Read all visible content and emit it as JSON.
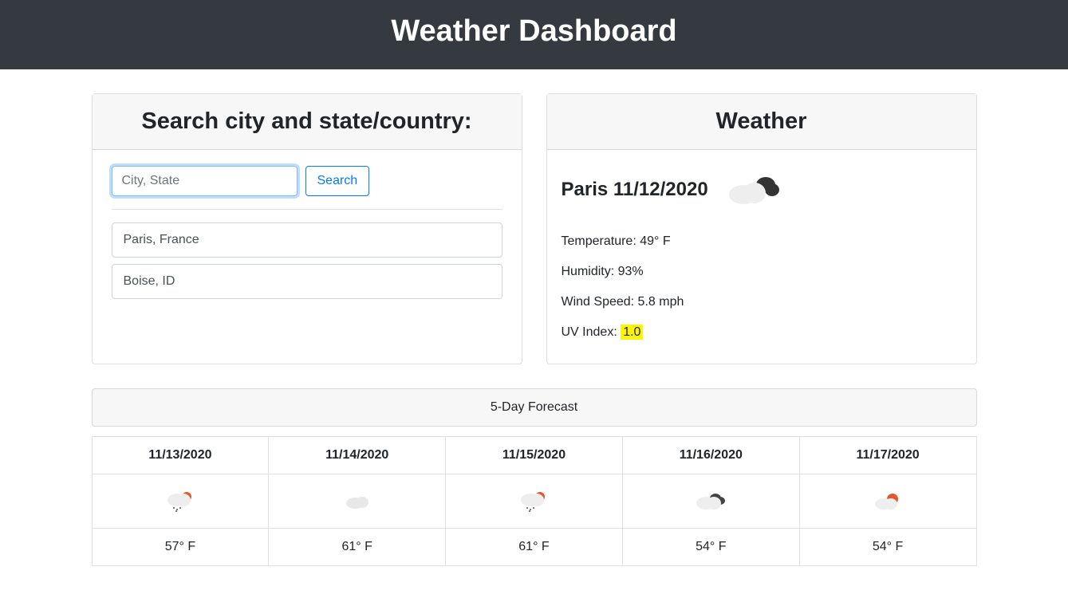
{
  "header": {
    "title": "Weather Dashboard"
  },
  "search": {
    "title": "Search city and state/country:",
    "placeholder": "City, State",
    "button_label": "Search",
    "history": [
      "Paris, France",
      "Boise, ID"
    ]
  },
  "current": {
    "header": "Weather",
    "title": "Paris 11/12/2020",
    "icon": "cloud-dark",
    "temperature_label": "Temperature: 49° F",
    "humidity_label": "Humidity: 93%",
    "wind_label": "Wind Speed: 5.8 mph",
    "uv_prefix": "UV Index: ",
    "uv_value": "1.0"
  },
  "forecast": {
    "header": "5-Day Forecast",
    "days": [
      {
        "date": "11/13/2020",
        "icon": "rain-sun",
        "temp": "57° F"
      },
      {
        "date": "11/14/2020",
        "icon": "cloud-light",
        "temp": "61° F"
      },
      {
        "date": "11/15/2020",
        "icon": "rain-sun",
        "temp": "61° F"
      },
      {
        "date": "11/16/2020",
        "icon": "cloud-gray",
        "temp": "54° F"
      },
      {
        "date": "11/17/2020",
        "icon": "cloud-sun",
        "temp": "54° F"
      }
    ]
  }
}
